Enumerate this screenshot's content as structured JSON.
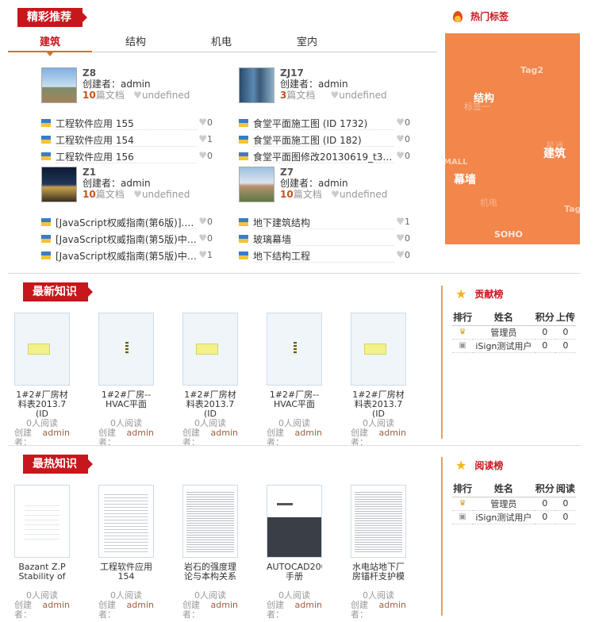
{
  "featured": {
    "title": "精彩推荐",
    "tabs": [
      "建筑",
      "结构",
      "机电",
      "室内"
    ],
    "groups": [
      {
        "name": "Z8",
        "creator_label": "创建者：",
        "creator": "admin",
        "doc_count": "10",
        "doc_unit": "篇文档",
        "likes": "undefined",
        "docs": [
          {
            "title": "工程软件应用 155",
            "likes": "0"
          },
          {
            "title": "工程软件应用 154",
            "likes": "1"
          },
          {
            "title": "工程软件应用 156",
            "likes": "0"
          }
        ]
      },
      {
        "name": "ZJ17",
        "creator_label": "创建者：",
        "creator": "admin",
        "doc_count": "3",
        "doc_unit": "篇文档",
        "likes": "undefined",
        "docs": [
          {
            "title": "食堂平面施工图 (ID 1732)",
            "likes": "0"
          },
          {
            "title": "食堂平面施工图 (ID 182)",
            "likes": "0"
          },
          {
            "title": "食堂平面图修改20130619_t3 (I...",
            "likes": "0"
          }
        ]
      },
      {
        "name": "Z1",
        "creator_label": "创建者：",
        "creator": "admin",
        "doc_count": "10",
        "doc_unit": "篇文档",
        "likes": "undefined",
        "docs": [
          {
            "title": "[JavaScript权威指南(第6版)].Dav...",
            "likes": "0"
          },
          {
            "title": "[JavaScript权威指南(第5版)中文...",
            "likes": "0"
          },
          {
            "title": "[JavaScript权威指南(第5版)中文...",
            "likes": "1"
          }
        ]
      },
      {
        "name": "Z7",
        "creator_label": "创建者：",
        "creator": "admin",
        "doc_count": "10",
        "doc_unit": "篇文档",
        "likes": "undefined",
        "docs": [
          {
            "title": "地下建筑结构",
            "likes": "1"
          },
          {
            "title": "玻璃幕墙",
            "likes": "0"
          },
          {
            "title": "地下结构工程",
            "likes": "0"
          }
        ]
      }
    ]
  },
  "hot_tags": {
    "title": "热门标签",
    "tags": [
      "Tag2",
      "结构",
      "标签一",
      "星洲",
      "建筑",
      "MALL",
      "幕墙",
      "机电",
      "Tag",
      "SOHO"
    ]
  },
  "latest": {
    "title": "最新知识",
    "items": [
      {
        "title": "1#2#厂房材料表2013.7 (ID",
        "reads": "0人阅读",
        "creator_label": "创建者：",
        "creator": "admin"
      },
      {
        "title": "1#2#厂房--HVAC平面",
        "reads": "0人阅读",
        "creator_label": "创建者：",
        "creator": "admin"
      },
      {
        "title": "1#2#厂房材料表2013.7 (ID",
        "reads": "0人阅读",
        "creator_label": "创建者：",
        "creator": "admin"
      },
      {
        "title": "1#2#厂房--HVAC平面",
        "reads": "0人阅读",
        "creator_label": "创建者：",
        "creator": "admin"
      },
      {
        "title": "1#2#厂房材料表2013.7 (ID",
        "reads": "0人阅读",
        "creator_label": "创建者：",
        "creator": "admin"
      }
    ]
  },
  "hottest": {
    "title": "最热知识",
    "items": [
      {
        "title": "Bazant Z.P Stability of",
        "reads": "0人阅读",
        "creator_label": "创建者：",
        "creator": "admin"
      },
      {
        "title": "工程软件应用 154",
        "reads": "0人阅读",
        "creator_label": "创建者：",
        "creator": "admin"
      },
      {
        "title": "岩石的强度理论与本构关系",
        "reads": "0人阅读",
        "creator_label": "创建者：",
        "creator": "admin"
      },
      {
        "title": "AUTOCAD200 手册",
        "reads": "0人阅读",
        "creator_label": "创建者：",
        "creator": "admin"
      },
      {
        "title": "水电站地下厂房锚杆支护模",
        "reads": "0人阅读",
        "creator_label": "创建者：",
        "creator": "admin"
      }
    ]
  },
  "contrib_rank": {
    "title": "贡献榜",
    "headers": [
      "排行",
      "姓名",
      "积分",
      "上传"
    ],
    "rows": [
      {
        "name": "管理员",
        "score": "0",
        "count": "0"
      },
      {
        "name": "iSign测试用户",
        "score": "0",
        "count": "0"
      }
    ]
  },
  "read_rank": {
    "title": "阅读榜",
    "headers": [
      "排行",
      "姓名",
      "积分",
      "阅读"
    ],
    "rows": [
      {
        "name": "管理员",
        "score": "0",
        "count": "0"
      },
      {
        "name": "iSign测试用户",
        "score": "0",
        "count": "0"
      }
    ]
  },
  "colors": {
    "accent": "#c8161d",
    "tag_cloud_bg": "#f2864b",
    "tab_underline": "#d8701c"
  }
}
